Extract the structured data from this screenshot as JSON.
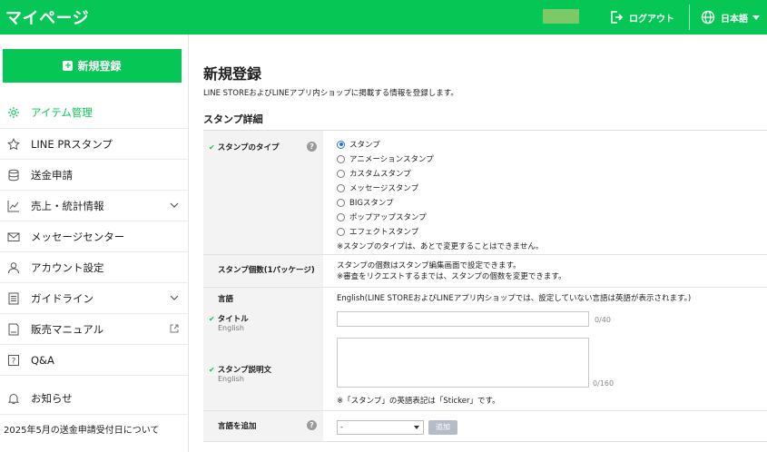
{
  "header": {
    "title": "マイページ",
    "logout_label": "ログアウト",
    "language_label": "日本語"
  },
  "sidebar": {
    "new_button_label": "新規登録",
    "items": [
      {
        "label": "アイテム管理",
        "icon": "gear-icon"
      },
      {
        "label": "LINE PRスタンプ",
        "icon": "star-icon"
      },
      {
        "label": "送金申請",
        "icon": "coins-icon"
      },
      {
        "label": "売上・統計情報",
        "icon": "chart-icon"
      },
      {
        "label": "メッセージセンター",
        "icon": "mail-icon"
      },
      {
        "label": "アカウント設定",
        "icon": "user-icon"
      },
      {
        "label": "ガイドライン",
        "icon": "document-icon"
      },
      {
        "label": "販売マニュアル",
        "icon": "book-icon"
      },
      {
        "label": "Q&A",
        "icon": "question-icon"
      }
    ],
    "notice_label": "お知らせ",
    "notice_text": "2025年5月の送金申請受付日について"
  },
  "main": {
    "title": "新規登録",
    "description": "LINE STOREおよびLINEアプリ内ショップに掲載する情報を登録します。",
    "section_title": "スタンプ詳細",
    "type_row": {
      "label": "スタンプのタイプ",
      "options": [
        "スタンプ",
        "アニメーションスタンプ",
        "カスタムスタンプ",
        "メッセージスタンプ",
        "BIGスタンプ",
        "ポップアップスタンプ",
        "エフェクトスタンプ"
      ],
      "selected_index": 0,
      "note": "※スタンプのタイプは、あとで変更することはできません。"
    },
    "count_row": {
      "label": "スタンプ個数(1パッケージ)",
      "line1": "スタンプの個数はスタンプ編集画面で設定できます。",
      "line2": "※審査をリクエストするまでは、スタンプの個数を変更できます。"
    },
    "language_row": {
      "label": "言語",
      "value": "English(LINE STOREおよびLINEアプリ内ショップでは、設定していない言語は英語が表示されます。)"
    },
    "title_row": {
      "label": "タイトル",
      "sub": "English",
      "value": "",
      "counter": "0/40"
    },
    "desc_row": {
      "label": "スタンプ説明文",
      "sub": "English",
      "value": "",
      "counter": "0/160",
      "note": "※「スタンプ」の英語表記は「Sticker」です。"
    },
    "add_lang_row": {
      "label": "言語を追加",
      "selected": "-",
      "button_label": "追加"
    }
  },
  "colors": {
    "brand_green": "#06c755",
    "radio_blue": "#2b6fd1"
  }
}
